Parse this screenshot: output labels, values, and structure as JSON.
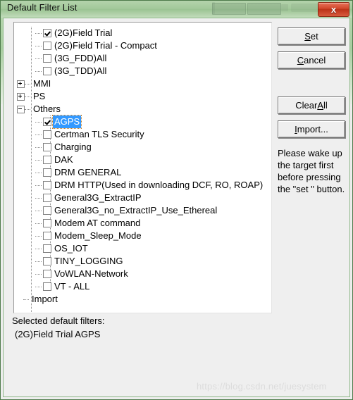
{
  "window": {
    "title": "Default Filter List",
    "close_icon": "close-icon",
    "close_glyph": "x"
  },
  "tree": {
    "nodes": [
      {
        "label": "(2G)Field Trial",
        "level": 2,
        "checkbox": true,
        "checked": true,
        "selected": false
      },
      {
        "label": "(2G)Field Trial - Compact",
        "level": 2,
        "checkbox": true,
        "checked": false,
        "selected": false
      },
      {
        "label": "(3G_FDD)All",
        "level": 2,
        "checkbox": true,
        "checked": false,
        "selected": false
      },
      {
        "label": "(3G_TDD)All",
        "level": 2,
        "checkbox": true,
        "checked": false,
        "selected": false
      },
      {
        "label": "MMI",
        "level": 1,
        "checkbox": false,
        "checked": false,
        "selected": false,
        "expander": "plus"
      },
      {
        "label": "PS",
        "level": 1,
        "checkbox": false,
        "checked": false,
        "selected": false,
        "expander": "plus"
      },
      {
        "label": "Others",
        "level": 1,
        "checkbox": false,
        "checked": false,
        "selected": false,
        "expander": "minus"
      },
      {
        "label": "AGPS",
        "level": 2,
        "checkbox": true,
        "checked": true,
        "selected": true
      },
      {
        "label": "Certman TLS Security",
        "level": 2,
        "checkbox": true,
        "checked": false,
        "selected": false
      },
      {
        "label": "Charging",
        "level": 2,
        "checkbox": true,
        "checked": false,
        "selected": false
      },
      {
        "label": "DAK",
        "level": 2,
        "checkbox": true,
        "checked": false,
        "selected": false
      },
      {
        "label": "DRM GENERAL",
        "level": 2,
        "checkbox": true,
        "checked": false,
        "selected": false
      },
      {
        "label": "DRM HTTP(Used in downloading DCF, RO, ROAP)",
        "level": 2,
        "checkbox": true,
        "checked": false,
        "selected": false
      },
      {
        "label": "General3G_ExtractIP",
        "level": 2,
        "checkbox": true,
        "checked": false,
        "selected": false
      },
      {
        "label": "General3G_no_ExtractIP_Use_Ethereal",
        "level": 2,
        "checkbox": true,
        "checked": false,
        "selected": false
      },
      {
        "label": "Modem AT command",
        "level": 2,
        "checkbox": true,
        "checked": false,
        "selected": false
      },
      {
        "label": "Modem_Sleep_Mode",
        "level": 2,
        "checkbox": true,
        "checked": false,
        "selected": false
      },
      {
        "label": "OS_IOT",
        "level": 2,
        "checkbox": true,
        "checked": false,
        "selected": false
      },
      {
        "label": "TINY_LOGGING",
        "level": 2,
        "checkbox": true,
        "checked": false,
        "selected": false
      },
      {
        "label": "VoWLAN-Network",
        "level": 2,
        "checkbox": true,
        "checked": false,
        "selected": false
      },
      {
        "label": "VT - ALL",
        "level": 2,
        "checkbox": true,
        "checked": false,
        "selected": false
      },
      {
        "label": "Import",
        "level": 1,
        "checkbox": false,
        "checked": false,
        "selected": false,
        "expander": "none"
      }
    ]
  },
  "buttons": {
    "set": {
      "accel": "S",
      "rest": "et"
    },
    "cancel": {
      "accel": "C",
      "rest": "ancel"
    },
    "clear_all": {
      "pre": "Clear ",
      "accel": "A",
      "rest": "ll"
    },
    "import": {
      "accel": "I",
      "rest": "mport..."
    }
  },
  "help": {
    "text": "Please wake up the target first before pressing the \"set \" button."
  },
  "footer": {
    "label": "Selected default filters:",
    "value": "(2G)Field Trial  AGPS"
  },
  "watermark": {
    "text": "https://blog.csdn.net/juesystem"
  },
  "colors": {
    "titlebar_green": "#a2c89a",
    "frame_border": "#4d7a4a",
    "dialog_bg": "#efefef",
    "selection_blue": "#3399ff",
    "close_red": "#d2482c"
  }
}
